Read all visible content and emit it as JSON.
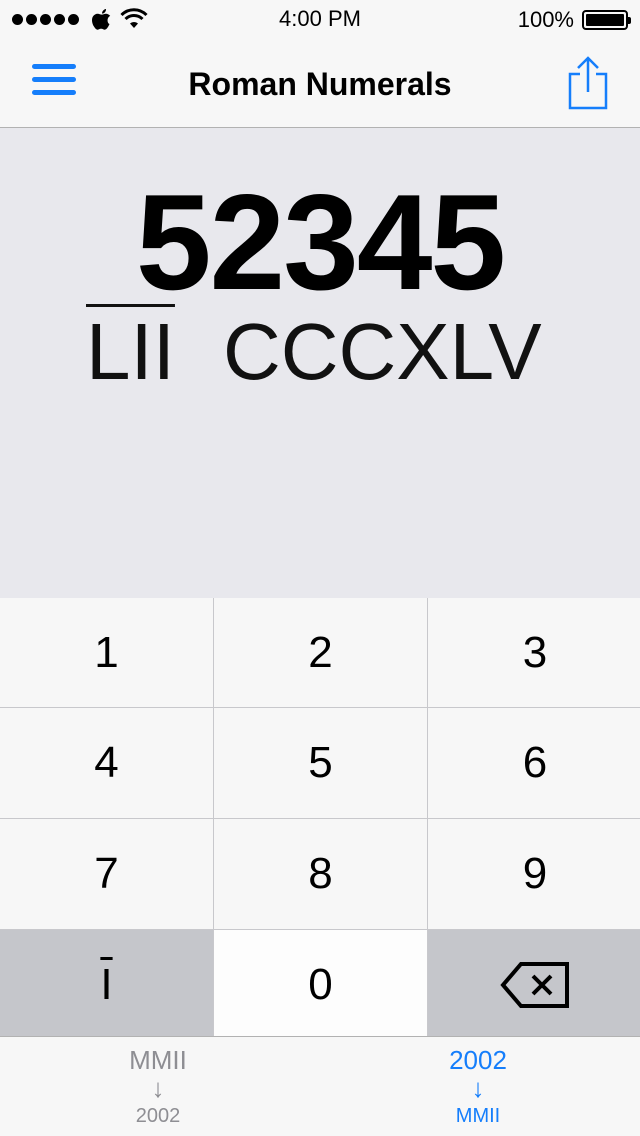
{
  "status_bar": {
    "time": "4:00 PM",
    "battery_percent": "100%",
    "signal_bars": 5
  },
  "nav": {
    "title": "Roman Numerals",
    "menu_icon": "hamburger-menu-icon",
    "share_icon": "share-icon"
  },
  "display": {
    "number": "52345",
    "roman_overlined": "LII",
    "roman_regular": "CCCXLV"
  },
  "keypad": {
    "keys": [
      "1",
      "2",
      "3",
      "4",
      "5",
      "6",
      "7",
      "8",
      "9",
      "I",
      "0"
    ],
    "overline_key": "I",
    "delete_icon": "backspace-icon"
  },
  "tabs": [
    {
      "top": "MMII",
      "arrow": "↓",
      "bottom": "2002",
      "active": false
    },
    {
      "top": "2002",
      "arrow": "↓",
      "bottom": "MMII",
      "active": true
    }
  ],
  "colors": {
    "accent": "#157efb",
    "display_bg": "#e8e8ed",
    "dark_key": "#c5c6cb",
    "inactive_tab": "#8e8e93"
  }
}
